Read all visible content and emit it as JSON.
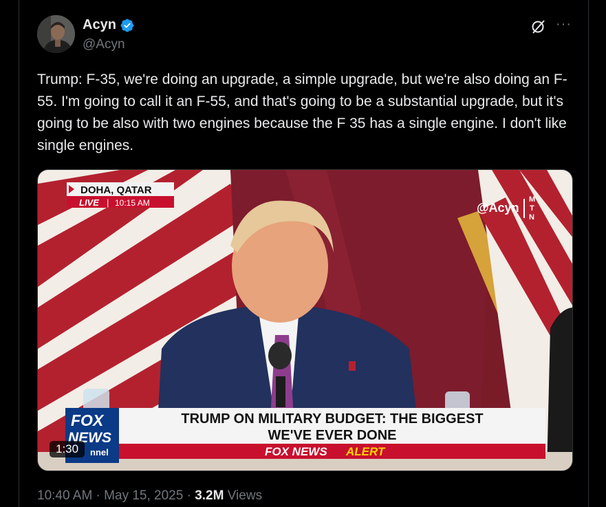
{
  "author": {
    "display_name": "Acyn",
    "handle": "@Acyn",
    "verified": true,
    "verified_color": "#1d9bf0"
  },
  "tweet": {
    "text": "Trump: F-35, we're doing an upgrade, a simple upgrade, but we're also doing an F-55. I'm going to call it an F-55, and that's going to be a substantial upgrade, but it's going to be also with two engines because the F 35 has a single engine. I don't like single engines."
  },
  "media": {
    "location": "DOHA, QATAR",
    "live_label": "LIVE",
    "live_time": "10:15 AM",
    "watermark": "@Acyn",
    "mtn": [
      "M",
      "T",
      "N"
    ],
    "network_line1": "FOX",
    "network_line2": "NEWS",
    "channel_fragment": "nnel",
    "chyron_line1": "TRUMP ON MILITARY BUDGET: THE BIGGEST",
    "chyron_line2": "WE'VE EVER DONE",
    "alert_brand": "FOX NEWS",
    "alert_word": "ALERT",
    "duration": "1:30"
  },
  "meta": {
    "time": "10:40 AM",
    "sep1": " · ",
    "date": "May 15, 2025",
    "sep2": " · ",
    "views_count": "3.2M",
    "views_label": " Views"
  },
  "icons": {
    "grok": "grok-icon",
    "more": "more-icon",
    "verified": "verified-badge-icon"
  }
}
